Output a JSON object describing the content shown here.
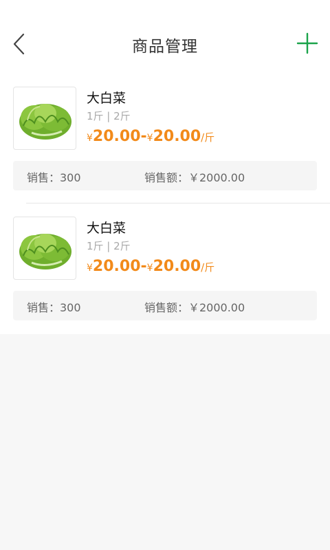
{
  "header": {
    "title": "商品管理",
    "back_icon": "chevron-left-icon",
    "add_icon": "plus-icon",
    "accent_color": "#1aa34a"
  },
  "products": [
    {
      "name": "大白菜",
      "spec": "1斤 | 2斤",
      "price": {
        "yen": "¥",
        "min": "20.00",
        "sep": "-",
        "max": "20.00",
        "unit": "/斤"
      },
      "sales": "销售：300",
      "revenue": "销售额：￥2000.00",
      "image_icon": "lettuce-image"
    },
    {
      "name": "大白菜",
      "spec": "1斤 | 2斤",
      "price": {
        "yen": "¥",
        "min": "20.00",
        "sep": "-",
        "max": "20.00",
        "unit": "/斤"
      },
      "sales": "销售：300",
      "revenue": "销售额：￥2000.00",
      "image_icon": "lettuce-image"
    }
  ],
  "colors": {
    "price": "#f28a1a",
    "background": "#f7f7f7"
  }
}
